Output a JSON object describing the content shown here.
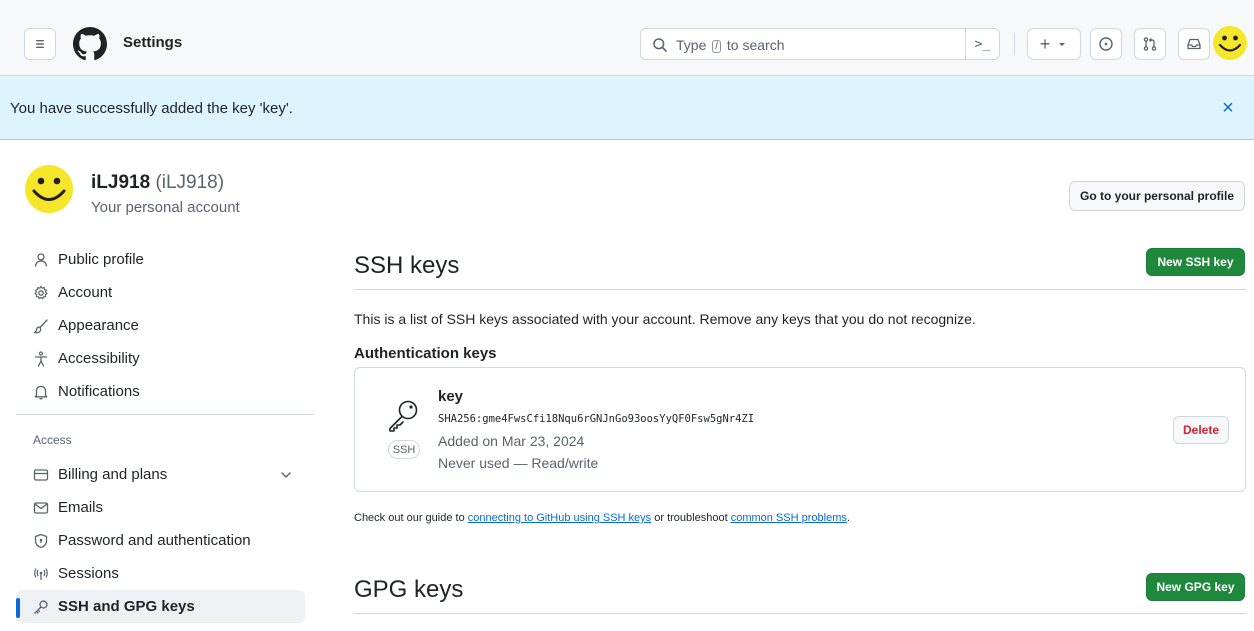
{
  "header": {
    "title": "Settings",
    "search": {
      "prefix": "Type",
      "key": "/",
      "suffix": "to search"
    },
    "command_palette": ">_",
    "plus": "+",
    "icons": [
      "menu-icon",
      "github-logo",
      "search-icon",
      "terminal-icon",
      "plus-icon",
      "issue-icon",
      "pull-request-icon",
      "inbox-icon"
    ]
  },
  "flash": {
    "message": "You have successfully added the key 'key'.",
    "close": "×"
  },
  "profile": {
    "name": "iLJ918",
    "handle": "(iLJ918)",
    "subtitle": "Your personal account",
    "go_to_profile": "Go to your personal profile"
  },
  "sidebar": {
    "items": [
      {
        "label": "Public profile",
        "icon": "person-icon"
      },
      {
        "label": "Account",
        "icon": "gear-icon"
      },
      {
        "label": "Appearance",
        "icon": "paintbrush-icon"
      },
      {
        "label": "Accessibility",
        "icon": "accessibility-icon"
      },
      {
        "label": "Notifications",
        "icon": "bell-icon"
      }
    ],
    "access_heading": "Access",
    "access_items": [
      {
        "label": "Billing and plans",
        "icon": "credit-card-icon"
      },
      {
        "label": "Emails",
        "icon": "mail-icon"
      },
      {
        "label": "Password and authentication",
        "icon": "shield-lock-icon"
      },
      {
        "label": "Sessions",
        "icon": "broadcast-icon"
      },
      {
        "label": "SSH and GPG keys",
        "icon": "key-icon"
      }
    ]
  },
  "ssh": {
    "title": "SSH keys",
    "new_button": "New SSH key",
    "description": "This is a list of SSH keys associated with your account. Remove any keys that you do not recognize.",
    "auth_heading": "Authentication keys",
    "key": {
      "name": "key",
      "fingerprint": "SHA256:gme4FwsCfi18Nqu6rGNJnGo93oosYyQF0Fsw5gNr4ZI",
      "added": "Added on Mar 23, 2024",
      "usage": "Never used — Read/write",
      "type_badge": "SSH",
      "delete": "Delete"
    },
    "guide": {
      "prefix": "Check out our guide to",
      "link1": "connecting to GitHub using SSH keys",
      "middle": "or troubleshoot",
      "link2": "common SSH problems",
      "suffix": "."
    }
  },
  "gpg": {
    "title": "GPG keys",
    "new_button": "New GPG key"
  },
  "colors": {
    "accent": "#0969da",
    "primary_button": "#1f883d",
    "danger": "#d1242f",
    "flash_bg": "#ddf4ff"
  }
}
